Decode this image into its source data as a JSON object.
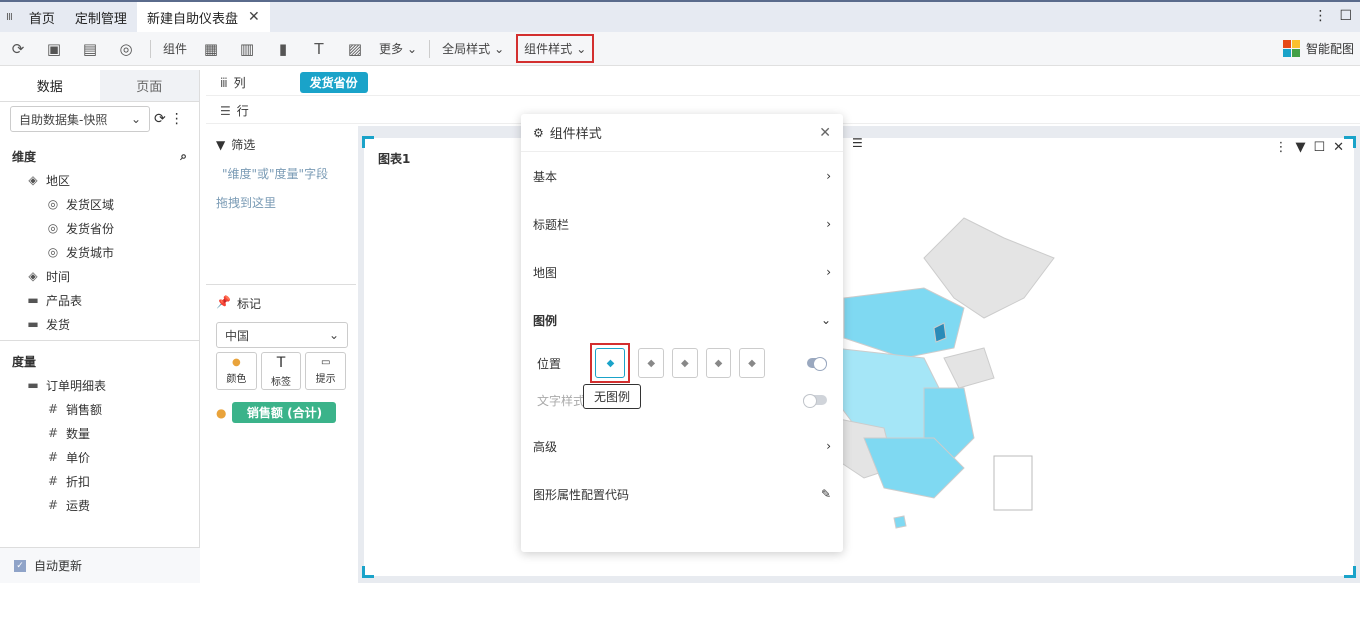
{
  "tabs": {
    "menu": "Ⅲ",
    "home": "首页",
    "custom": "定制管理",
    "active": "新建自助仪表盘",
    "close": "✕"
  },
  "toolbar": {
    "component": "组件",
    "more": "更多",
    "global_style": "全局样式",
    "comp_style": "组件样式",
    "smart": "智能配图"
  },
  "left": {
    "tab_data": "数据",
    "tab_page": "页面",
    "dataset": "自助数据集-快照",
    "dim_title": "维度",
    "measure_title": "度量",
    "dims": [
      {
        "label": "地区",
        "level": 0
      },
      {
        "label": "发货区域",
        "level": 1
      },
      {
        "label": "发货省份",
        "level": 1
      },
      {
        "label": "发货城市",
        "level": 1
      },
      {
        "label": "时间",
        "level": 0
      },
      {
        "label": "产品表",
        "level": 0
      },
      {
        "label": "发货",
        "level": 0
      }
    ],
    "measures": [
      {
        "label": "订单明细表",
        "level": 0
      },
      {
        "label": "销售额",
        "level": 1
      },
      {
        "label": "数量",
        "level": 1
      },
      {
        "label": "单价",
        "level": 1
      },
      {
        "label": "折扣",
        "level": 1
      },
      {
        "label": "运费",
        "level": 1
      }
    ],
    "auto_update": "自动更新"
  },
  "shelf": {
    "col_label": "列",
    "row_label": "行",
    "col_pill": "发货省份"
  },
  "filter": {
    "title": "筛选",
    "hint1": "\"维度\"或\"度量\"字段",
    "hint2": "拖拽到这里"
  },
  "marks": {
    "title": "标记",
    "select": "中国",
    "color": "颜色",
    "label": "标签",
    "tip": "提示",
    "measure_pill": "销售额 (合计)"
  },
  "chart": {
    "title": "图表1"
  },
  "panel": {
    "title": "组件样式",
    "basic": "基本",
    "titlebar": "标题栏",
    "map": "地图",
    "legend": "图例",
    "position": "位置",
    "text_style": "文字样式",
    "tooltip": "无图例",
    "advanced": "高级",
    "code": "图形属性配置代码"
  },
  "colors": {
    "accent": "#1aa3c9",
    "highlight": "#d32f2f"
  }
}
